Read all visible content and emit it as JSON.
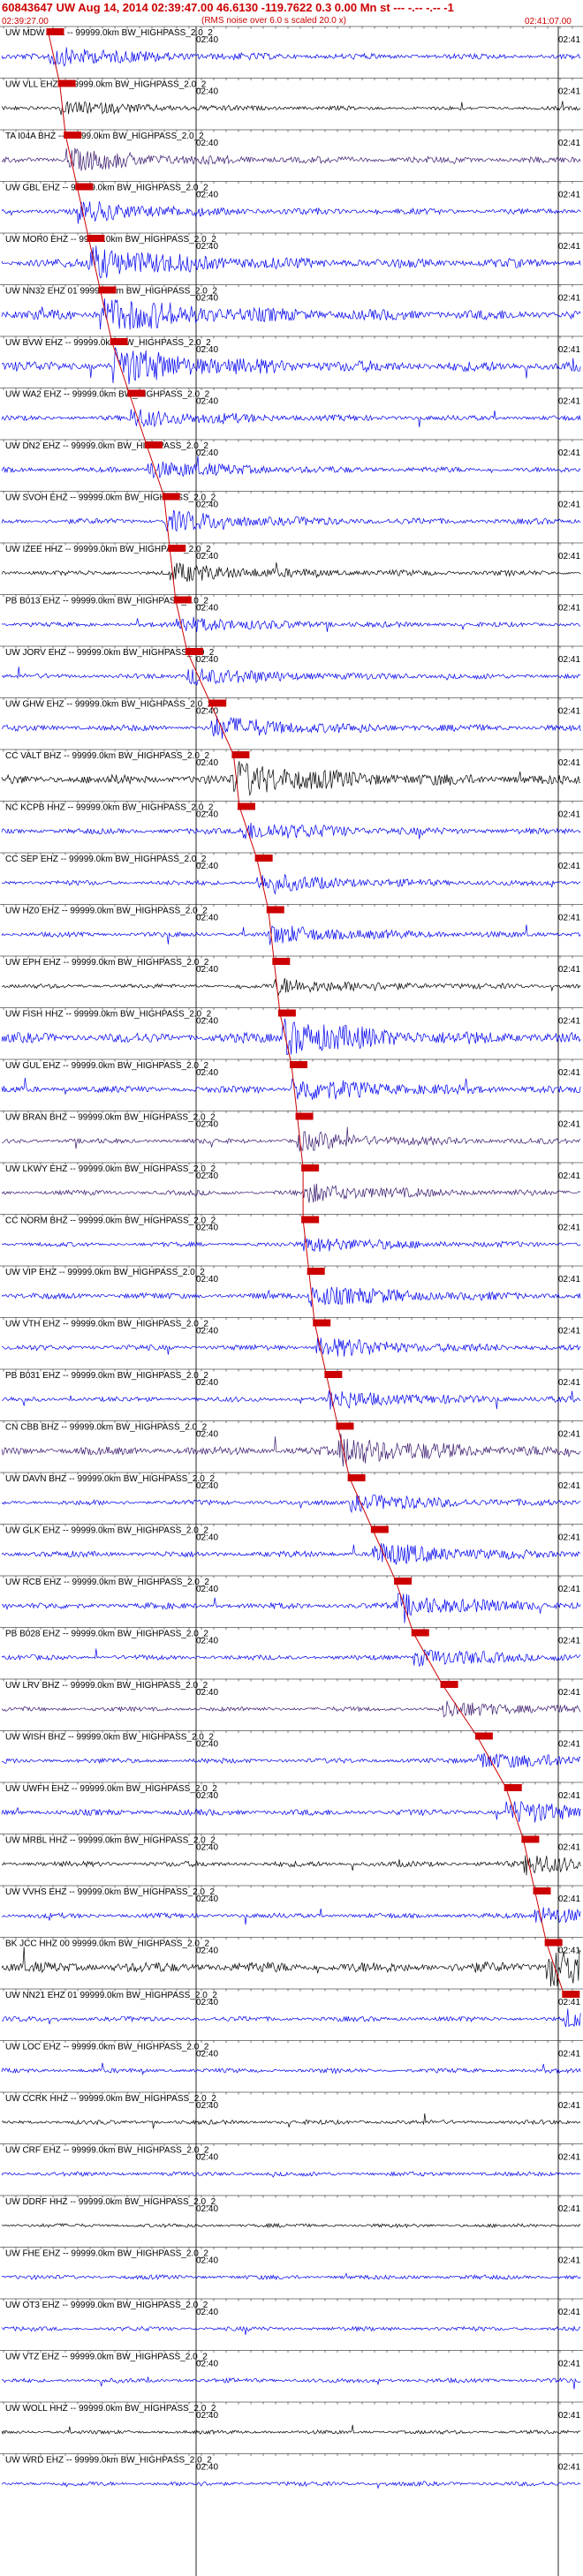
{
  "header": {
    "title": "60843647 UW Aug 14, 2014 02:39:47.00   46.6130 -119.7622  0.3 0.00 Mn st --- -.-- -.--  -1",
    "subtitle": "(RMS noise over 6.0 s scaled 20.0 x)",
    "start_time": "02:39:27.00",
    "end_time": "02:41:07.00"
  },
  "chart_data": {
    "type": "seismogram",
    "time_marks": {
      "t1": "02:40",
      "t2": "02:41"
    },
    "grid": true,
    "pick_color": "#cc0000",
    "trace_colors": {
      "blue": "#0000ee",
      "black": "#000000",
      "purple": "#3a1a6e"
    },
    "traces": [
      {
        "name": "UW MDW EHZ -- 99999.0km BW_HIGHPASS_2.0_2",
        "pick": 0.08,
        "color": "blue",
        "amp": 0.5
      },
      {
        "name": "UW VLL EHZ -- 99999.0km BW_HIGHPASS_2.0_2",
        "pick": 0.1,
        "color": "black",
        "amp": 0.35
      },
      {
        "name": "TA I04A BHZ -- 99999.0km BW_HIGHPASS_2.0_2",
        "pick": 0.11,
        "color": "purple",
        "amp": 0.55
      },
      {
        "name": "UW GBL EHZ -- 99999.0km BW_HIGHPASS_2.0_2",
        "pick": 0.13,
        "color": "blue",
        "amp": 0.5
      },
      {
        "name": "UW MOR0 EHZ -- 99999.0km BW_HIGHPASS_2.0_2",
        "pick": 0.15,
        "color": "blue",
        "amp": 0.8
      },
      {
        "name": "UW NN32 EHZ 01 99999.0km BW_HIGHPASS_2.0_2",
        "pick": 0.17,
        "color": "blue",
        "amp": 0.9
      },
      {
        "name": "UW BVW EHZ -- 99999.0km BW_HIGHPASS_2.0_2",
        "pick": 0.19,
        "color": "blue",
        "amp": 0.9
      },
      {
        "name": "UW WA2 EHZ -- 99999.0km BW_HIGHPASS_2.0_2",
        "pick": 0.22,
        "color": "blue",
        "amp": 0.45
      },
      {
        "name": "UW DN2 EHZ -- 99999.0km BW_HIGHPASS_2.0_2",
        "pick": 0.25,
        "color": "blue",
        "amp": 0.45
      },
      {
        "name": "UW SVOH EHZ -- 99999.0km BW_HIGHPASS_2.0_2",
        "pick": 0.28,
        "color": "blue",
        "amp": 0.5
      },
      {
        "name": "UW IZEE HHZ -- 99999.0km BW_HIGHPASS_2.0_2",
        "pick": 0.29,
        "color": "black",
        "amp": 0.45
      },
      {
        "name": "PB B013 EHZ -- 99999.0km BW_HIGHPASS_2.0_2",
        "pick": 0.3,
        "color": "blue",
        "amp": 0.4
      },
      {
        "name": "UW JORV EHZ -- 99999.0km BW_HIGHPASS_2.0_2",
        "pick": 0.32,
        "color": "blue",
        "amp": 0.45
      },
      {
        "name": "UW GHW EHZ -- 99999.0km BW_HIGHPASS_2.0_2",
        "pick": 0.36,
        "color": "blue",
        "amp": 0.55
      },
      {
        "name": "CC VALT BHZ -- 99999.0km BW_HIGHPASS_2.0_2",
        "pick": 0.4,
        "color": "black",
        "amp": 0.85
      },
      {
        "name": "NC KCPB HHZ -- 99999.0km BW_HIGHPASS_2.0_2",
        "pick": 0.41,
        "color": "blue",
        "amp": 0.5
      },
      {
        "name": "CC SEP EHZ -- 99999.0km BW_HIGHPASS_2.0_2",
        "pick": 0.44,
        "color": "blue",
        "amp": 0.45
      },
      {
        "name": "UW HZ0 EHZ -- 99999.0km BW_HIGHPASS_2.0_2",
        "pick": 0.46,
        "color": "blue",
        "amp": 0.45
      },
      {
        "name": "UW EPH EHZ -- 99999.0km BW_HIGHPASS_2.0_2",
        "pick": 0.47,
        "color": "black",
        "amp": 0.4
      },
      {
        "name": "UW FISH HHZ -- 99999.0km BW_HIGHPASS_2.0_2",
        "pick": 0.48,
        "color": "blue",
        "amp": 0.9
      },
      {
        "name": "UW GUL EHZ -- 99999.0km BW_HIGHPASS_2.0_2",
        "pick": 0.5,
        "color": "blue",
        "amp": 0.6
      },
      {
        "name": "UW BRAN BHZ -- 99999.0km BW_HIGHPASS_2.0_2",
        "pick": 0.51,
        "color": "purple",
        "amp": 0.45
      },
      {
        "name": "UW LKWY EHZ -- 99999.0km BW_HIGHPASS_2.0_2",
        "pick": 0.52,
        "color": "purple",
        "amp": 0.45
      },
      {
        "name": "CC NORM BHZ -- 99999.0km BW_HIGHPASS_2.0_2",
        "pick": 0.52,
        "color": "blue",
        "amp": 0.4
      },
      {
        "name": "UW VIP EHZ -- 99999.0km BW_HIGHPASS_2.0_2",
        "pick": 0.53,
        "color": "blue",
        "amp": 0.55
      },
      {
        "name": "UW VTH EHZ -- 99999.0km BW_HIGHPASS_2.0_2",
        "pick": 0.54,
        "color": "blue",
        "amp": 0.5
      },
      {
        "name": "PB B031 EHZ -- 99999.0km BW_HIGHPASS_2.0_2",
        "pick": 0.56,
        "color": "blue",
        "amp": 0.45
      },
      {
        "name": "CN CBB BHZ -- 99999.0km BW_HIGHPASS_2.0_2",
        "pick": 0.58,
        "color": "purple",
        "amp": 0.75
      },
      {
        "name": "UW DAVN BHZ -- 99999.0km BW_HIGHPASS_2.0_2",
        "pick": 0.6,
        "color": "blue",
        "amp": 0.45
      },
      {
        "name": "UW GLK EHZ -- 99999.0km BW_HIGHPASS_2.0_2",
        "pick": 0.64,
        "color": "blue",
        "amp": 0.55
      },
      {
        "name": "UW RCB EHZ -- 99999.0km BW_HIGHPASS_2.0_2",
        "pick": 0.68,
        "color": "blue",
        "amp": 0.55
      },
      {
        "name": "PB B028 EHZ -- 99999.0km BW_HIGHPASS_2.0_2",
        "pick": 0.71,
        "color": "blue",
        "amp": 0.45
      },
      {
        "name": "UW LRV BHZ -- 99999.0km BW_HIGHPASS_2.0_2",
        "pick": 0.76,
        "color": "purple",
        "amp": 0.4
      },
      {
        "name": "UW WISH BHZ -- 99999.0km BW_HIGHPASS_2.0_2",
        "pick": 0.82,
        "color": "blue",
        "amp": 0.45
      },
      {
        "name": "UW UWFH EHZ -- 99999.0km BW_HIGHPASS_2.0_2",
        "pick": 0.87,
        "color": "blue",
        "amp": 0.55
      },
      {
        "name": "UW MRBL HHZ -- 99999.0km BW_HIGHPASS_2.0_2",
        "pick": 0.9,
        "color": "black",
        "amp": 0.5
      },
      {
        "name": "UW VVHS EHZ -- 99999.0km BW_HIGHPASS_2.0_2",
        "pick": 0.92,
        "color": "blue",
        "amp": 0.45
      },
      {
        "name": "BK JCC HHZ 00 99999.0km BW_HIGHPASS_2.0_2",
        "pick": 0.94,
        "color": "black",
        "amp": 0.95
      },
      {
        "name": "UW NN21 EHZ 01 99999.0km BW_HIGHPASS_2.0_2",
        "pick": 0.97,
        "color": "blue",
        "amp": 0.45
      },
      {
        "name": "UW LOC EHZ -- 99999.0km BW_HIGHPASS_2.0_2",
        "pick": null,
        "color": "blue",
        "amp": 0.4
      },
      {
        "name": "UW CCRK HHZ -- 99999.0km BW_HIGHPASS_2.0_2",
        "pick": null,
        "color": "black",
        "amp": 0.4
      },
      {
        "name": "UW CRF EHZ -- 99999.0km BW_HIGHPASS_2.0_2",
        "pick": null,
        "color": "blue",
        "amp": 0.4
      },
      {
        "name": "UW DDRF HHZ -- 99999.0km BW_HIGHPASS_2.0_2",
        "pick": null,
        "color": "black",
        "amp": 0.35
      },
      {
        "name": "UW FHE EHZ -- 99999.0km BW_HIGHPASS_2.0_2",
        "pick": null,
        "color": "blue",
        "amp": 0.4
      },
      {
        "name": "UW OT3 EHZ -- 99999.0km BW_HIGHPASS_2.0_2",
        "pick": null,
        "color": "blue",
        "amp": 0.4
      },
      {
        "name": "UW VTZ EHZ -- 99999.0km BW_HIGHPASS_2.0_2",
        "pick": null,
        "color": "blue",
        "amp": 0.4
      },
      {
        "name": "UW WOLL HHZ -- 99999.0km BW_HIGHPASS_2.0_2",
        "pick": null,
        "color": "black",
        "amp": 0.35
      },
      {
        "name": "UW WRD EHZ -- 99999.0km BW_HIGHPASS_2.0_2",
        "pick": null,
        "color": "blue",
        "amp": 0.4
      }
    ]
  }
}
